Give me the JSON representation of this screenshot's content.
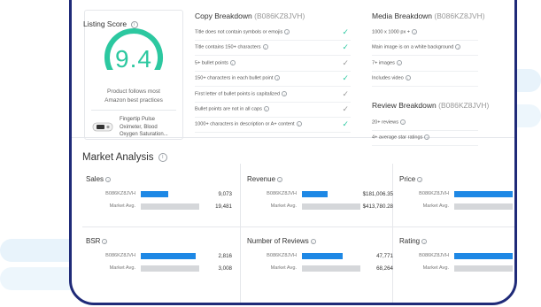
{
  "listing_score": {
    "title": "Listing Score",
    "score": "9.4",
    "score_fraction": 0.94,
    "note_line1": "Product follows most",
    "note_line2": "Amazon best practices",
    "product_name_line1": "Fingertip Pulse",
    "product_name_line2": "Oximeter, Blood",
    "product_name_line3": "Oxygen Saturation..."
  },
  "copy_breakdown": {
    "title": "Copy Breakdown",
    "asin": "(B086KZ8JVH)",
    "rows": [
      {
        "label": "Title does not contain symbols or emojis",
        "check": "✓",
        "status": "pass"
      },
      {
        "label": "Title contains 150+ characters",
        "check": "✓",
        "status": "pass"
      },
      {
        "label": "5+ bullet points",
        "check": "✓",
        "status": "fail"
      },
      {
        "label": "150+ characters in each bullet point",
        "check": "✓",
        "status": "pass"
      },
      {
        "label": "First letter of bullet points is capitalized",
        "check": "✓",
        "status": "fail"
      },
      {
        "label": "Bullet points are not in all caps",
        "check": "✓",
        "status": "fail"
      },
      {
        "label": "1000+ characters in description or A+ content",
        "check": "✓",
        "status": "pass"
      }
    ]
  },
  "media_breakdown": {
    "title": "Media Breakdown",
    "asin": "(B086KZ8JVH)",
    "rows": [
      {
        "label": "1000 x 1000 px +"
      },
      {
        "label": "Main image is on a white background"
      },
      {
        "label": "7+ images"
      },
      {
        "label": "Includes video"
      }
    ]
  },
  "review_breakdown": {
    "title": "Review Breakdown",
    "asin": "(B086KZ8JVH)",
    "rows": [
      {
        "label": "20+ reviews"
      },
      {
        "label": "4+ average star ratings"
      }
    ]
  },
  "market_analysis": {
    "title": "Market Analysis",
    "metrics": [
      {
        "title": "Sales",
        "asin_label": "B086KZ8JVH",
        "asin_value": "9,073",
        "avg_label": "Market Avg.",
        "avg_value": "19,481",
        "asin_fraction": 0.47,
        "avg_fraction": 1.0
      },
      {
        "title": "Revenue",
        "asin_label": "B086KZ8JVH",
        "asin_value": "$181,006.35",
        "avg_label": "Market Avg.",
        "avg_value": "$413,780.28",
        "asin_fraction": 0.44,
        "avg_fraction": 1.0
      },
      {
        "title": "Price",
        "asin_label": "B086KZ8JVH",
        "asin_value": "",
        "avg_label": "Market Avg.",
        "avg_value": "",
        "asin_fraction": 1.0,
        "avg_fraction": 1.0
      },
      {
        "title": "BSR",
        "asin_label": "B086KZ8JVH",
        "asin_value": "2,816",
        "avg_label": "Market Avg.",
        "avg_value": "3,008",
        "asin_fraction": 0.94,
        "avg_fraction": 1.0
      },
      {
        "title": "Number of Reviews",
        "asin_label": "B086KZ8JVH",
        "asin_value": "47,771",
        "avg_label": "Market Avg.",
        "avg_value": "68,264",
        "asin_fraction": 0.7,
        "avg_fraction": 1.0
      },
      {
        "title": "Rating",
        "asin_label": "B086KZ8JVH",
        "asin_value": "",
        "avg_label": "Market Avg.",
        "avg_value": "",
        "asin_fraction": 1.0,
        "avg_fraction": 1.0
      }
    ]
  },
  "colors": {
    "accent_teal": "#2cc8a0",
    "bar_blue": "#1e88e5",
    "bar_grey": "#d5d7da",
    "frame_navy": "#1f2a78"
  }
}
